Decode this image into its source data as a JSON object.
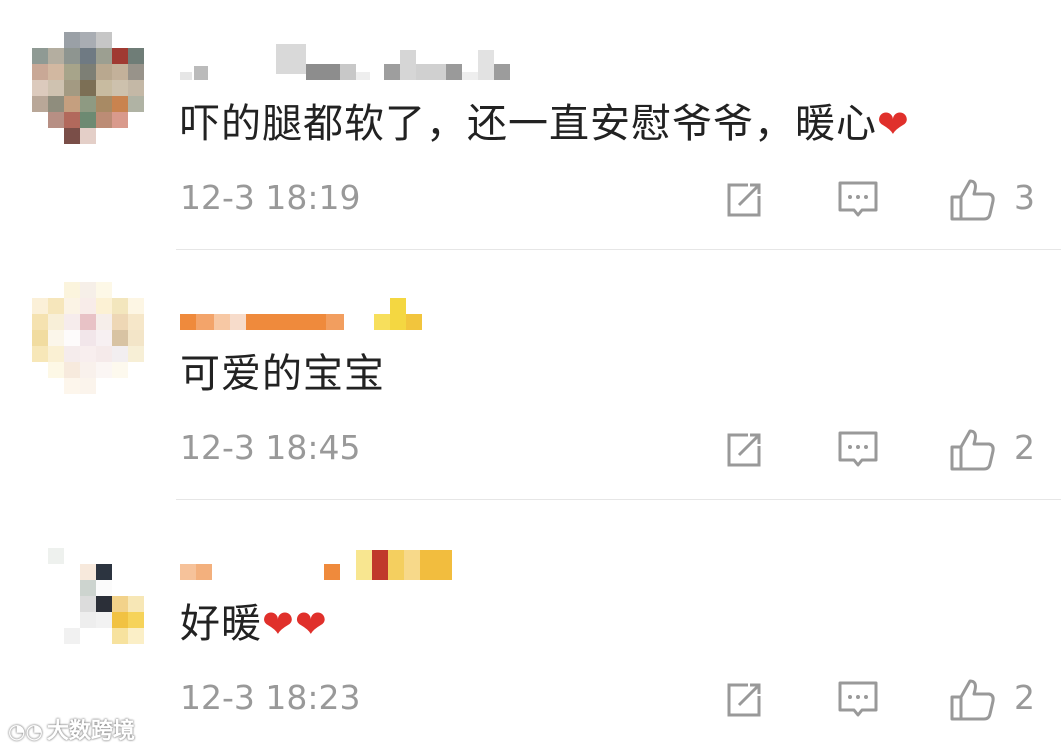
{
  "comments": [
    {
      "text": "吓的腿都软了，还一直安慰爷爷，暖心",
      "emoji": "❤",
      "time": "12-3 18:19",
      "likes": "3"
    },
    {
      "text": "可爱的宝宝",
      "emoji": "",
      "time": "12-3 18:45",
      "likes": "2"
    },
    {
      "text": "好暖",
      "emoji": "❤❤",
      "time": "12-3 18:23",
      "likes": "2"
    }
  ],
  "icons": {
    "share": "share-icon",
    "reply": "reply-icon",
    "like": "thumbs-up-icon"
  },
  "colors": {
    "heart": "#e0302b",
    "meta": "#999999",
    "text": "#222222",
    "divider": "#e6e6e6"
  },
  "watermark": {
    "text": "大数跨境"
  }
}
